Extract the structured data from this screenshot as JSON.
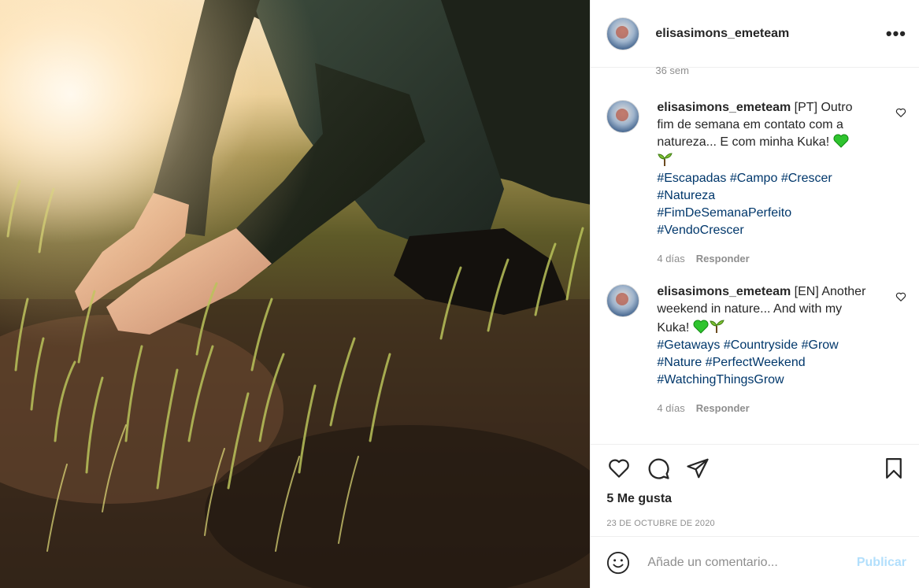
{
  "post": {
    "username": "elisasimons_emeteam",
    "more_label": "•••",
    "previous_time": "36 sem"
  },
  "comments": [
    {
      "username": "elisasimons_emeteam",
      "text_1": " [PT] Outro fim de semana em contato com a natureza... E com minha Kuka! ",
      "tags": [
        "#Escapadas",
        "#Campo",
        "#Crescer",
        "#Natureza",
        "#FimDeSemanaPerfeito",
        "#VendoCrescer"
      ],
      "time": "4 días",
      "reply_label": "Responder"
    },
    {
      "username": "elisasimons_emeteam",
      "text_1": " [EN] Another weekend in nature... And with my Kuka! ",
      "tags": [
        "#Getaways",
        "#Countryside",
        "#Grow",
        "#Nature",
        "#PerfectWeekend",
        "#WatchingThingsGrow"
      ],
      "time": "4 días",
      "reply_label": "Responder"
    }
  ],
  "likes": "5 Me gusta",
  "date": "23 DE OCTUBRE DE 2020",
  "add_comment": {
    "placeholder": "Añade un comentario...",
    "publish_label": "Publicar"
  },
  "icons": {
    "like": "heart-icon",
    "comment": "speech-bubble-icon",
    "share": "paper-plane-icon",
    "save": "bookmark-icon",
    "emoji": "smiley-icon",
    "green_heart": "green-heart-emoji",
    "seedling": "seedling-emoji"
  },
  "colors": {
    "hashtag": "#00376b",
    "muted": "#8e8e8e",
    "publish_disabled": "#b2dffc",
    "green_heart": "#2fc42f"
  }
}
